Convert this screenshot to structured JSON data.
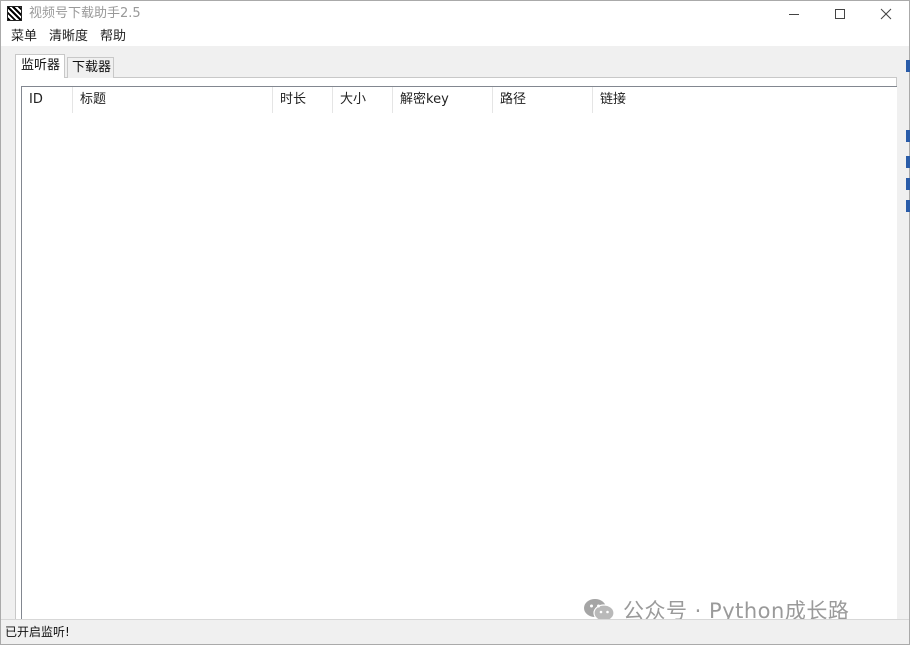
{
  "window": {
    "title": "视频号下载助手2.5"
  },
  "menu": {
    "items": [
      "菜单",
      "清晰度",
      "帮助"
    ]
  },
  "tabs": [
    {
      "label": "监听器",
      "active": true
    },
    {
      "label": "下载器",
      "active": false
    }
  ],
  "table": {
    "columns": [
      "ID",
      "标题",
      "时长",
      "大小",
      "解密key",
      "路径",
      "链接"
    ],
    "rows": []
  },
  "status": {
    "text": "已开启监听!"
  },
  "watermark": {
    "text": "公众号 · Python成长路",
    "icon": "wechat-icon"
  },
  "colors": {
    "window_bg": "#f0f0f0",
    "title_text": "#999999",
    "watermark": "#9a9a9a"
  }
}
